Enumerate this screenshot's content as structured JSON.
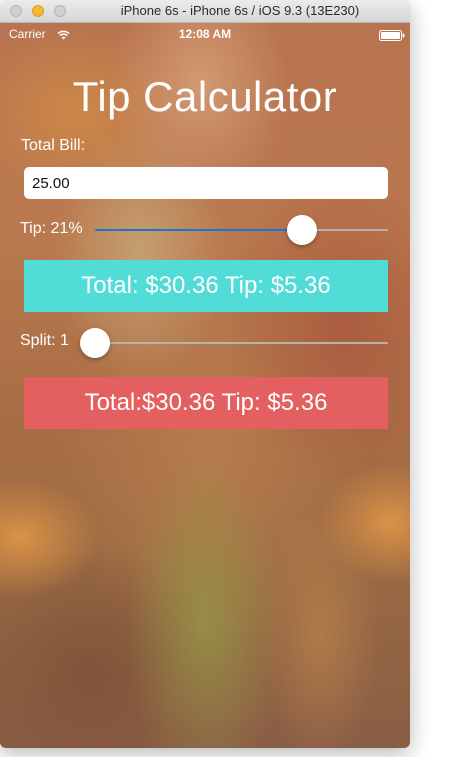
{
  "window": {
    "title": "iPhone 6s - iPhone 6s / iOS 9.3 (13E230)"
  },
  "status_bar": {
    "carrier": "Carrier",
    "time": "12:08 AM",
    "icons": [
      "wifi-icon",
      "battery-icon"
    ]
  },
  "app": {
    "title": "Tip Calculator",
    "bill": {
      "label": "Total Bill:",
      "value": "25.00"
    },
    "tip": {
      "label": "Tip: 21%",
      "percent": 21,
      "slider_fraction": 0.73
    },
    "total_result": {
      "text": "Total: $30.36 Tip: $5.36"
    },
    "split": {
      "label": "Split: 1",
      "value": 1,
      "slider_fraction": 0
    },
    "split_result": {
      "text": "Total:$30.36 Tip: $5.36"
    }
  },
  "colors": {
    "total_box": "#52dcd7",
    "split_box": "#e45f5f",
    "slider_fill": "#1e72d9"
  }
}
